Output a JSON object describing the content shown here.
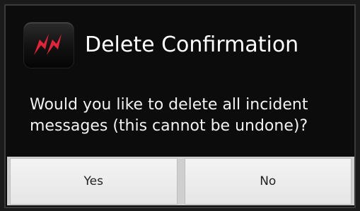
{
  "dialog": {
    "title": "Delete Confirmation",
    "icon": "incident-app-icon",
    "message_lines": [
      "Would you like to delete all incident",
      "messages (this cannot be undone)?"
    ],
    "buttons": {
      "yes_label": "Yes",
      "no_label": "No"
    }
  },
  "colors": {
    "dialog_background": "#0c0c0c",
    "button_background": "#e6e6e6",
    "icon_accent": "#e0243a"
  }
}
